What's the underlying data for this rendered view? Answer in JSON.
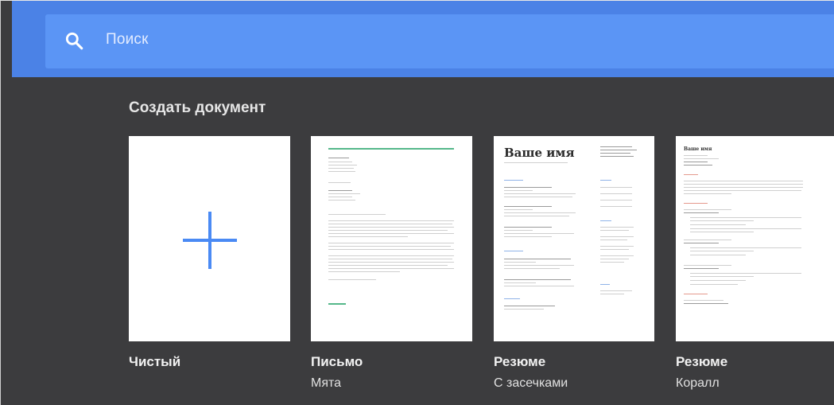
{
  "search": {
    "icon": "search-icon",
    "placeholder": "Поиск"
  },
  "section": {
    "title": "Создать документ"
  },
  "templates": [
    {
      "title": "Чистый",
      "subtitle": ""
    },
    {
      "title": "Письмо",
      "subtitle": "Мята"
    },
    {
      "title": "Резюме",
      "subtitle": "С засечками",
      "preview_heading": "Ваше имя"
    },
    {
      "title": "Резюме",
      "subtitle": "Коралл",
      "preview_heading": "Ваше имя"
    }
  ],
  "colors": {
    "background": "#3c3c3e",
    "header": "#4b82e6",
    "search_bar": "#5b95f5",
    "plus_accent": "#4a8af4",
    "mint_accent": "#55b88a",
    "coral_accent": "#e59a8e"
  }
}
